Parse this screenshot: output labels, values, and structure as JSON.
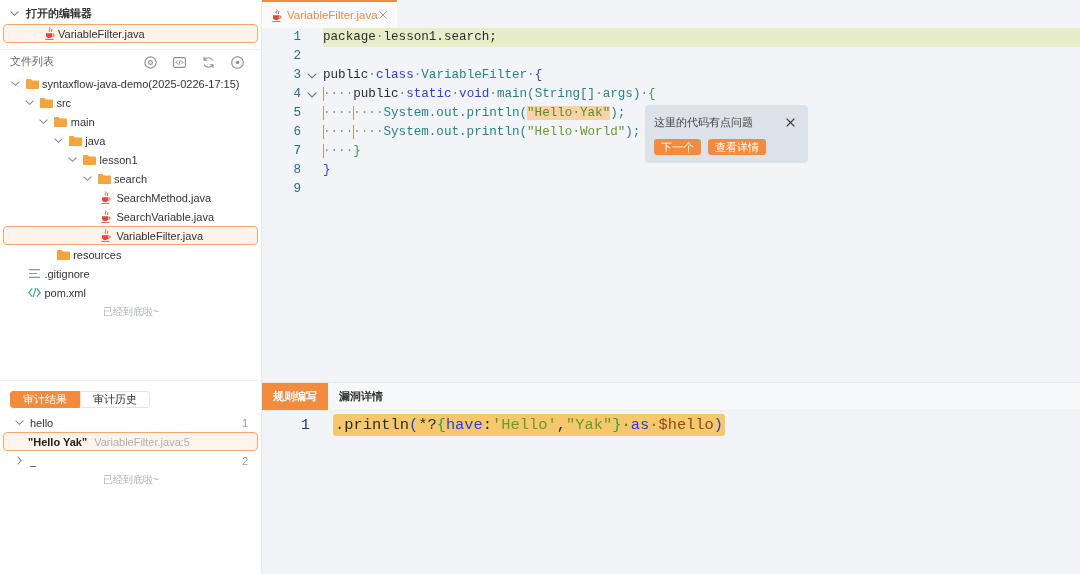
{
  "sidebar": {
    "open_editors": {
      "title": "打开的编辑器",
      "expanded": true,
      "items": [
        {
          "name": "VariableFilter.java",
          "kind": "java",
          "selected": true
        }
      ]
    },
    "file_list": {
      "title": "文件列表",
      "tree": [
        {
          "name": "syntaxflow-java-demo(2025-0226-17:15)",
          "kind": "folder",
          "expanded": true,
          "selected": false,
          "children": [
            {
              "name": "src",
              "kind": "folder",
              "expanded": true,
              "selected": false,
              "children": [
                {
                  "name": "main",
                  "kind": "folder",
                  "expanded": true,
                  "selected": false,
                  "children": [
                    {
                      "name": "java",
                      "kind": "folder",
                      "expanded": true,
                      "selected": false,
                      "children": [
                        {
                          "name": "lesson1",
                          "kind": "folder",
                          "expanded": true,
                          "selected": false,
                          "children": [
                            {
                              "name": "search",
                              "kind": "folder",
                              "expanded": true,
                              "selected": false,
                              "children": [
                                {
                                  "name": "SearchMethod.java",
                                  "kind": "java",
                                  "selected": false
                                },
                                {
                                  "name": "SearchVariable.java",
                                  "kind": "java",
                                  "selected": false
                                },
                                {
                                  "name": "VariableFilter.java",
                                  "kind": "java",
                                  "selected": true
                                }
                              ]
                            }
                          ]
                        }
                      ]
                    },
                    {
                      "name": "resources",
                      "kind": "folder",
                      "selected": false
                    }
                  ]
                }
              ]
            },
            {
              "name": ".gitignore",
              "kind": "text",
              "selected": false
            },
            {
              "name": "pom.xml",
              "kind": "xml",
              "selected": false
            }
          ]
        }
      ],
      "end_note": "已经到底啦~"
    },
    "audit": {
      "tabs": [
        {
          "label": "审计结果",
          "selected": true
        },
        {
          "label": "审计历史",
          "selected": false
        }
      ],
      "groups": [
        {
          "name": "hello",
          "count": "1",
          "expanded": true,
          "results": [
            {
              "value": "\"Hello Yak\"",
              "location": "VariableFilter.java:5",
              "selected": true
            }
          ]
        },
        {
          "name": "_",
          "count": "2",
          "expanded": false
        }
      ],
      "end_note": "已经到底啦~"
    }
  },
  "editor": {
    "tabs": [
      {
        "label": "VariableFilter.java",
        "kind": "java",
        "selected": true
      }
    ],
    "lines": [
      {
        "number": "1",
        "highlighted": true,
        "fold": false,
        "tokens": [
          {
            "kind": "plain",
            "text": "package"
          },
          {
            "kind": "space",
            "text": "·"
          },
          {
            "kind": "plain",
            "text": "lesson1.search;"
          }
        ]
      },
      {
        "number": "2",
        "highlighted": false,
        "fold": false
      },
      {
        "number": "3",
        "highlighted": false,
        "fold": true,
        "tokens": [
          {
            "kind": "plain",
            "text": "public"
          },
          {
            "kind": "space",
            "text": "·"
          },
          {
            "kind": "keyword",
            "text": "class"
          },
          {
            "kind": "space",
            "text": "·"
          },
          {
            "kind": "type",
            "text": "VariableFilter"
          },
          {
            "kind": "space",
            "text": "·"
          },
          {
            "kind": "brace",
            "text": "{"
          }
        ]
      },
      {
        "number": "4",
        "highlighted": false,
        "fold": true,
        "tokens": [
          {
            "kind": "indent",
            "text": "····"
          },
          {
            "kind": "plain",
            "text": "public"
          },
          {
            "kind": "space",
            "text": "·"
          },
          {
            "kind": "keyword",
            "text": "static"
          },
          {
            "kind": "space",
            "text": "·"
          },
          {
            "kind": "keyword",
            "text": "void"
          },
          {
            "kind": "space",
            "text": "·"
          },
          {
            "kind": "type",
            "text": "main(String[]"
          },
          {
            "kind": "space",
            "text": "·"
          },
          {
            "kind": "type",
            "text": "args)"
          },
          {
            "kind": "space",
            "text": "·"
          },
          {
            "kind": "brace2",
            "text": "{"
          }
        ]
      },
      {
        "number": "5",
        "highlighted": false,
        "fold": false,
        "tokens": [
          {
            "kind": "indent",
            "text": "····"
          },
          {
            "kind": "indent",
            "text": "····"
          },
          {
            "kind": "type",
            "text": "System.out.println("
          },
          {
            "kind": "match",
            "text": "\"Hello·Yak\""
          },
          {
            "kind": "type",
            "text": ");"
          }
        ]
      },
      {
        "number": "6",
        "highlighted": false,
        "fold": false,
        "tokens": [
          {
            "kind": "indent",
            "text": "····"
          },
          {
            "kind": "indent",
            "text": "····"
          },
          {
            "kind": "type",
            "text": "System.out.println("
          },
          {
            "kind": "string",
            "text": "\"Hello·World\""
          },
          {
            "kind": "type",
            "text": ");"
          }
        ]
      },
      {
        "number": "7",
        "highlighted": false,
        "fold": false,
        "tokens": [
          {
            "kind": "indent",
            "text": "····"
          },
          {
            "kind": "brace2",
            "text": "}"
          }
        ]
      },
      {
        "number": "8",
        "highlighted": false,
        "fold": false,
        "tokens": [
          {
            "kind": "brace",
            "text": "}"
          }
        ]
      },
      {
        "number": "9",
        "highlighted": false,
        "fold": false
      }
    ],
    "popup": {
      "message": "这里的代码有点问题",
      "buttons": [
        "下一个",
        "查看详情"
      ]
    }
  },
  "rule_panel": {
    "tabs": [
      {
        "label": "规则编写",
        "selected": true
      },
      {
        "label": "漏洞详情",
        "selected": false
      }
    ],
    "lines": [
      {
        "number": "1",
        "highlighted": true,
        "tokens": [
          {
            "kind": "plain",
            "text": ".println"
          },
          {
            "kind": "brace",
            "text": "("
          },
          {
            "kind": "plain",
            "text": "*?"
          },
          {
            "kind": "brace2",
            "text": "{"
          },
          {
            "kind": "keyword",
            "text": "have"
          },
          {
            "kind": "plain",
            "text": ":"
          },
          {
            "kind": "string",
            "text": "'Hello'"
          },
          {
            "kind": "plain",
            "text": ","
          },
          {
            "kind": "string",
            "text": "\"Yak\""
          },
          {
            "kind": "brace2",
            "text": "}"
          },
          {
            "kind": "space",
            "text": "·"
          },
          {
            "kind": "keyword",
            "text": "as"
          },
          {
            "kind": "space",
            "text": "·"
          },
          {
            "kind": "var",
            "text": "$hello"
          },
          {
            "kind": "brace",
            "text": ")"
          }
        ]
      }
    ]
  }
}
